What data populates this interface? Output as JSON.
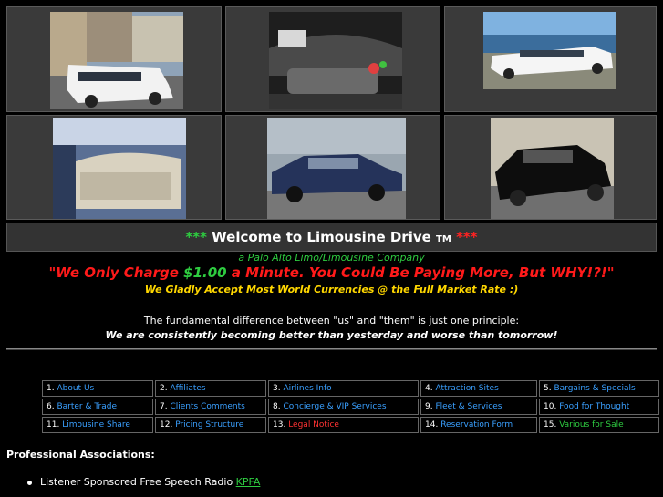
{
  "gallery": {
    "photos": [
      {
        "name": "white-limo-street-photo"
      },
      {
        "name": "limo-interior-bar-photo"
      },
      {
        "name": "white-stretch-limo-waterfront-photo"
      },
      {
        "name": "lincoln-rear-seat-photo"
      },
      {
        "name": "blue-lincoln-sedan-photo"
      },
      {
        "name": "black-lincoln-sedan-photo"
      }
    ]
  },
  "header": {
    "stars": "***",
    "title": "Welcome to Limousine Drive",
    "trademark": "TM"
  },
  "intro": {
    "subtitle": "a Palo Alto Limo/Limousine Company",
    "charge_prefix": "\"We Only Charge ",
    "charge_amount": "$1.00",
    "charge_suffix": " a Minute. You Could Be Paying More, But WHY!?!\"",
    "currencies": "We Gladly Accept Most World Currencies @ the Full Market Rate :)",
    "difference": "The fundamental difference between \"us\" and \"them\" is just one principle:",
    "principle": "We are consistently becoming better than yesterday and worse than tomorrow!"
  },
  "nav": {
    "rows": [
      [
        {
          "num": "1.",
          "label": "About Us",
          "color": "blue"
        },
        {
          "num": "2.",
          "label": "Affiliates",
          "color": "blue"
        },
        {
          "num": "3.",
          "label": "Airlines Info",
          "color": "blue"
        },
        {
          "num": "4.",
          "label": "Attraction Sites",
          "color": "blue"
        },
        {
          "num": "5.",
          "label": "Bargains & Specials",
          "color": "blue"
        }
      ],
      [
        {
          "num": "6.",
          "label": "Barter & Trade",
          "color": "blue"
        },
        {
          "num": "7.",
          "label": "Clients Comments",
          "color": "blue"
        },
        {
          "num": "8.",
          "label": "Concierge & VIP Services",
          "color": "blue"
        },
        {
          "num": "9.",
          "label": "Fleet & Services",
          "color": "blue"
        },
        {
          "num": "10.",
          "label": "Food for Thought",
          "color": "blue"
        }
      ],
      [
        {
          "num": "11.",
          "label": "Limousine Share",
          "color": "blue"
        },
        {
          "num": "12.",
          "label": "Pricing Structure",
          "color": "blue"
        },
        {
          "num": "13.",
          "label": "Legal Notice",
          "color": "red"
        },
        {
          "num": "14.",
          "label": "Reservation Form",
          "color": "blue"
        },
        {
          "num": "15.",
          "label": "Various for Sale",
          "color": "green"
        }
      ]
    ]
  },
  "associations": {
    "title": "Professional Associations:",
    "items": [
      {
        "text": "Listener Sponsored Free Speech Radio ",
        "link": "KPFA"
      }
    ]
  }
}
